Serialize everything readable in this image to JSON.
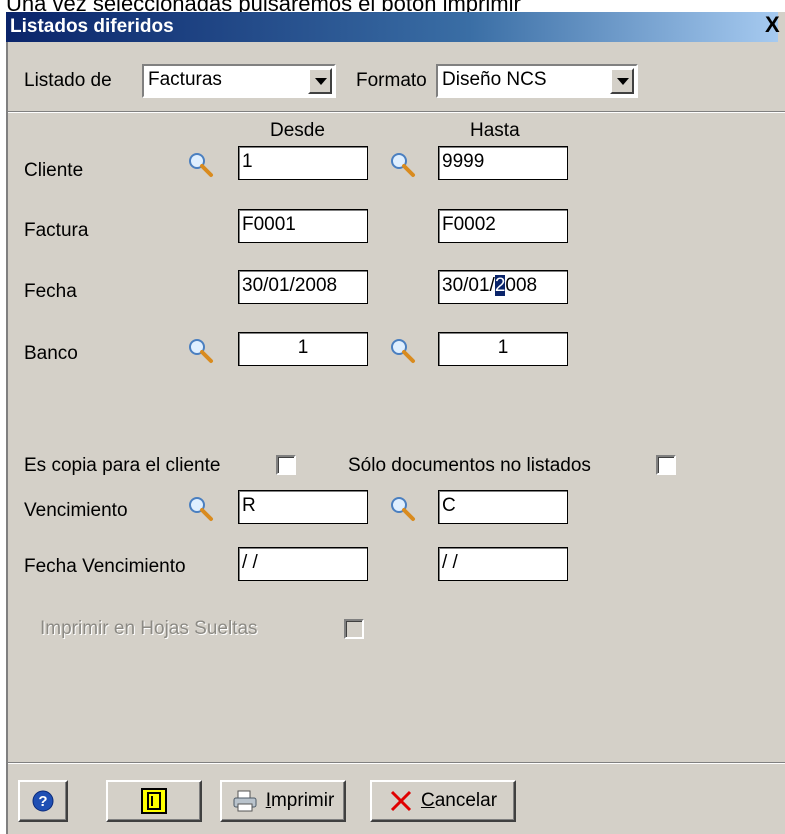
{
  "caption": "Una vez seleccionadas pulsaremos el botón imprimir",
  "window": {
    "title": "Listados diferidos",
    "close_glyph": "X"
  },
  "top": {
    "listado_label": "Listado de",
    "listado_value": "Facturas",
    "formato_label": "Formato",
    "formato_value": "Diseño NCS"
  },
  "columns": {
    "desde": "Desde",
    "hasta": "Hasta"
  },
  "rows": {
    "cliente": {
      "label": "Cliente",
      "desde": "1",
      "hasta": "9999"
    },
    "factura": {
      "label": "Factura",
      "desde": "F0001",
      "hasta": "F0002"
    },
    "fecha": {
      "label": "Fecha",
      "desde": "30/01/2008",
      "hasta_pre": "30/01/",
      "hasta_sel": "2",
      "hasta_post": "008"
    },
    "banco": {
      "label": "Banco",
      "desde": "1",
      "hasta": "1"
    },
    "vencimiento": {
      "label": "Vencimiento",
      "desde": "R",
      "hasta": "C"
    },
    "fecha_vencimiento": {
      "label": "Fecha Vencimiento",
      "desde": " / /",
      "hasta": " / /"
    }
  },
  "checks": {
    "copia_label": "Es copia para el cliente",
    "solo_label": "Sólo documentos no listados",
    "hojas_label": "Imprimir en Hojas Sueltas"
  },
  "buttons": {
    "imprimir_u": "I",
    "imprimir_rest": "mprimir",
    "cancelar_u": "C",
    "cancelar_rest": "ancelar"
  },
  "colors": {
    "title_bar": "#0a246a",
    "dialog_bg": "#d4d0c8",
    "help_icon": "#1f4fb4",
    "print_icon": "#ffff00"
  }
}
